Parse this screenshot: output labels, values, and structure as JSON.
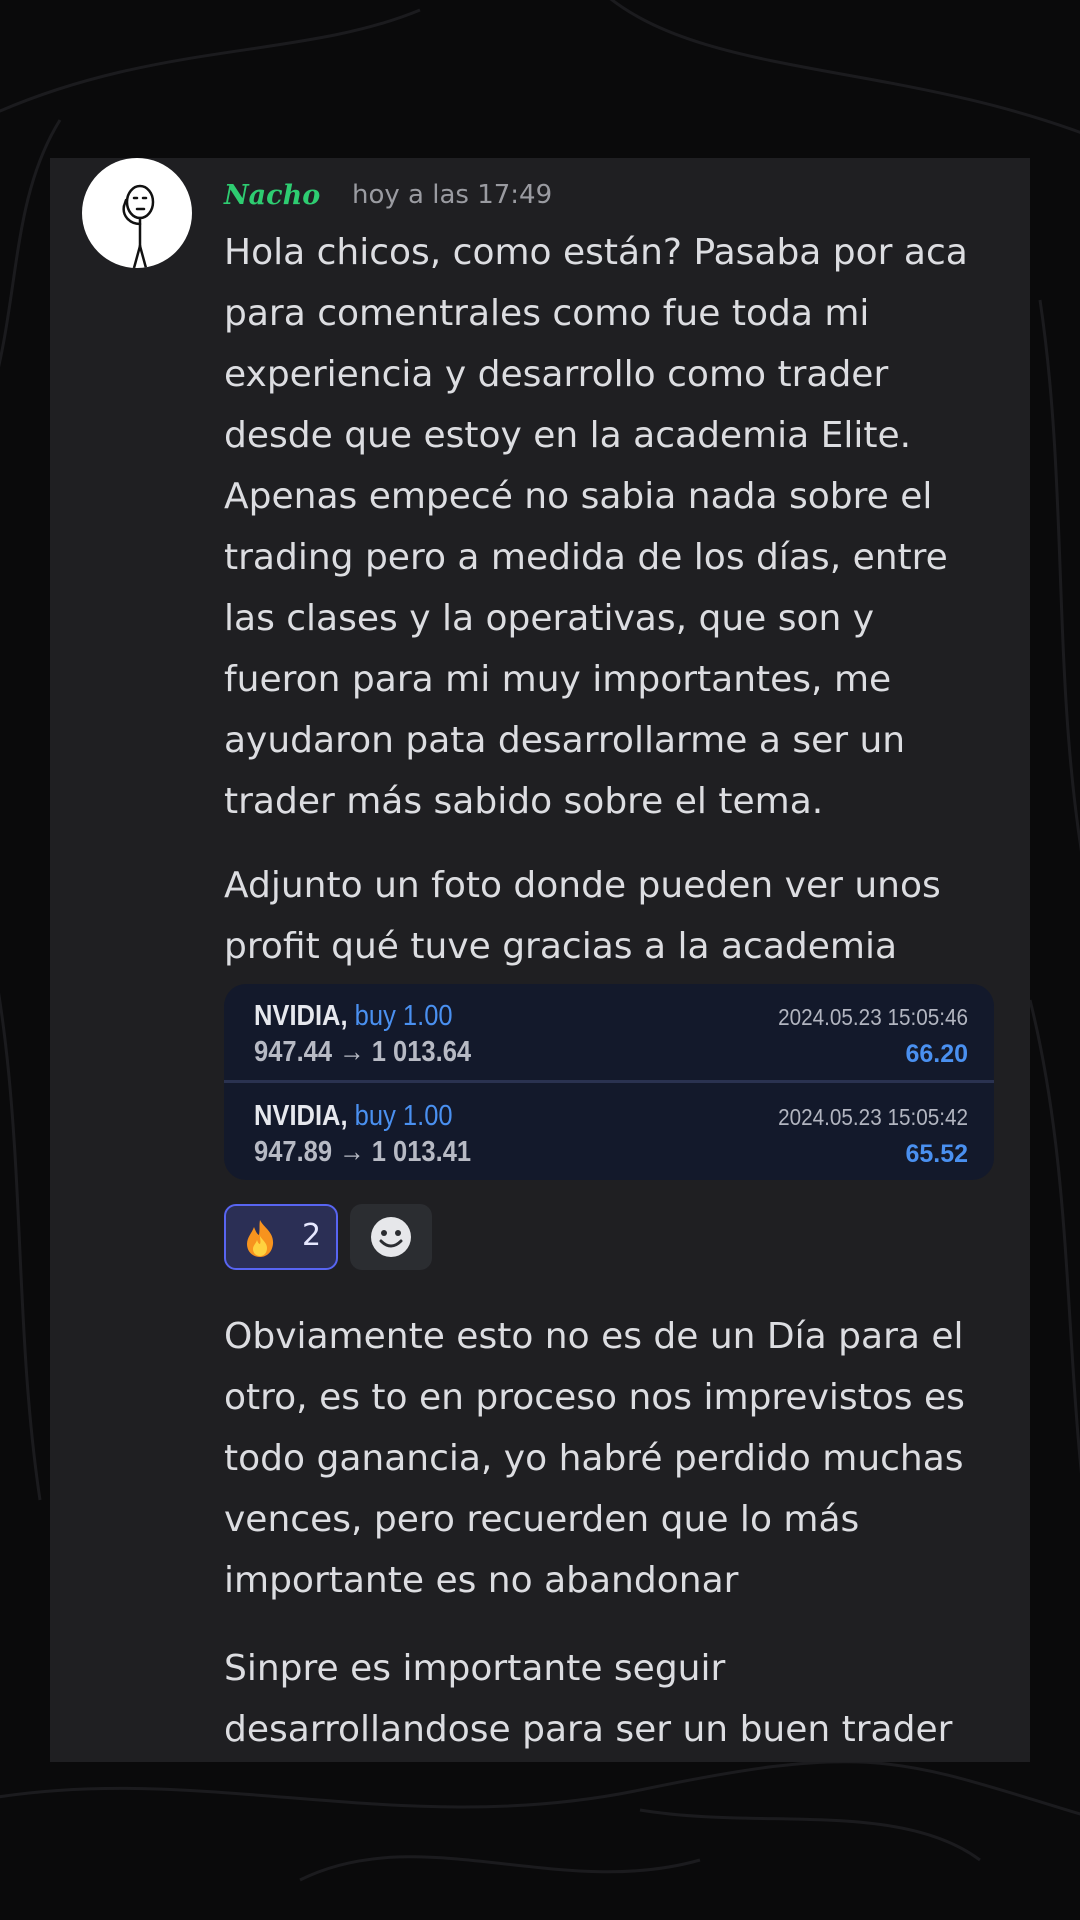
{
  "message": {
    "author": "Nacho",
    "timestamp": "hoy a las 17:49",
    "paragraph1_lines": [
      "Hola chicos, como están? Pasaba por aca",
      "para comentrales como fue toda mi",
      "experiencia y desarrollo como trader",
      "desde que estoy en la academia Elite.",
      "Apenas empecé no sabia nada sobre el",
      "trading pero a medida de los días, entre",
      "las clases y la operativas, que son y",
      "fueron para mi muy importantes, me",
      "ayudaron pata desarrollarme a ser un",
      "trader más sabido sobre el tema."
    ],
    "paragraph2_lines": [
      "Adjunto un foto donde pueden ver unos",
      "profit qué tuve gracias a la academia"
    ],
    "paragraph3_lines": [
      "Obviamente esto no es de un Día para el",
      "otro, es to en proceso nos imprevistos es",
      "todo ganancia, yo habré perdido muchas",
      "vences, pero recuerden que lo más",
      "importante es no abandonar"
    ],
    "paragraph4_lines": [
      "Sinpre es importante seguir",
      "desarrollandose para ser un buen trader"
    ]
  },
  "trades": [
    {
      "symbol": "NVIDIA,",
      "action": "buy 1.00",
      "prices": "947.44 → 1 013.64",
      "datetime": "2024.05.23 15:05:46",
      "profit": "66.20"
    },
    {
      "symbol": "NVIDIA,",
      "action": "buy 1.00",
      "prices": "947.89 → 1 013.41",
      "datetime": "2024.05.23 15:05:42",
      "profit": "65.52"
    }
  ],
  "reactions": [
    {
      "icon": "fire-emoji-icon",
      "count": "2"
    }
  ],
  "add_reaction_icon": "smiley-add-reaction-icon",
  "colors": {
    "username": "#2ecc71",
    "accent_profit": "#4a90f0",
    "reaction_border": "#5865f2",
    "card_bg": "#1f1f22"
  }
}
